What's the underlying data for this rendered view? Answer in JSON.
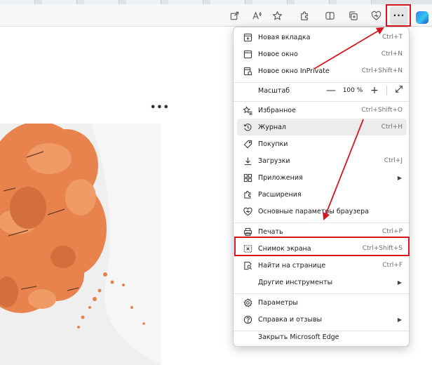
{
  "toolbar": {
    "icons": [
      "share-icon",
      "read-aloud-icon",
      "favorite-star-icon",
      "extensions-icon",
      "split-screen-icon",
      "collections-icon",
      "browser-essentials-icon"
    ],
    "more_label": "···"
  },
  "page": {
    "more_label": "•••"
  },
  "menu": {
    "items": {
      "new_tab": {
        "label": "Новая вкладка",
        "shortcut": "Ctrl+T"
      },
      "new_window": {
        "label": "Новое окно",
        "shortcut": "Ctrl+N"
      },
      "inprivate": {
        "label": "Новое окно InPrivate",
        "shortcut": "Ctrl+Shift+N"
      },
      "zoom": {
        "label": "Масштаб",
        "value": "100 %",
        "minus": "—",
        "plus": "+"
      },
      "favorites": {
        "label": "Избранное",
        "shortcut": "Ctrl+Shift+O"
      },
      "history": {
        "label": "Журнал",
        "shortcut": "Ctrl+H"
      },
      "shopping": {
        "label": "Покупки"
      },
      "downloads": {
        "label": "Загрузки",
        "shortcut": "Ctrl+J"
      },
      "apps": {
        "label": "Приложения"
      },
      "extensions": {
        "label": "Расширения"
      },
      "essentials": {
        "label": "Основные параметры браузера"
      },
      "print": {
        "label": "Печать",
        "shortcut": "Ctrl+P"
      },
      "screenshot": {
        "label": "Снимок экрана",
        "shortcut": "Ctrl+Shift+S"
      },
      "find": {
        "label": "Найти на странице",
        "shortcut": "Ctrl+F"
      },
      "more_tools": {
        "label": "Другие инструменты"
      },
      "settings": {
        "label": "Параметры"
      },
      "help": {
        "label": "Справка и отзывы"
      },
      "close": {
        "label": "Закрыть Microsoft Edge"
      }
    }
  },
  "colors": {
    "highlight": "#d6161e",
    "menu_hover": "#ececec",
    "photo_orange": "#e8834e"
  }
}
